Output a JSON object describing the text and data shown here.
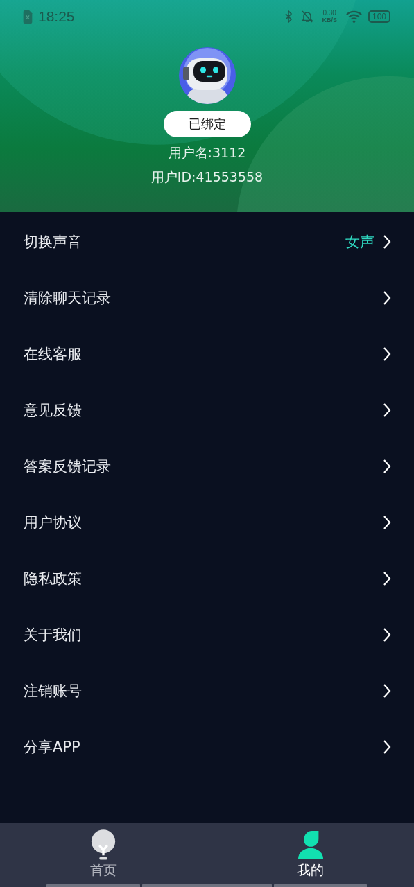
{
  "status_bar": {
    "time": "18:25",
    "speed_value": "0.30",
    "speed_unit": "KB/S",
    "battery": "100"
  },
  "profile": {
    "bind_status": "已绑定",
    "username": "用户名:3112",
    "user_id": "用户ID:41553558"
  },
  "menu": [
    {
      "label": "切换声音",
      "value": "女声"
    },
    {
      "label": "清除聊天记录"
    },
    {
      "label": "在线客服"
    },
    {
      "label": "意见反馈"
    },
    {
      "label": "答案反馈记录"
    },
    {
      "label": "用户协议"
    },
    {
      "label": "隐私政策"
    },
    {
      "label": "关于我们"
    },
    {
      "label": "注销账号"
    },
    {
      "label": "分享APP"
    }
  ],
  "tabs": [
    {
      "label": "首页",
      "kind": "home",
      "selected": false
    },
    {
      "label": "我的",
      "kind": "profile",
      "selected": true
    }
  ]
}
